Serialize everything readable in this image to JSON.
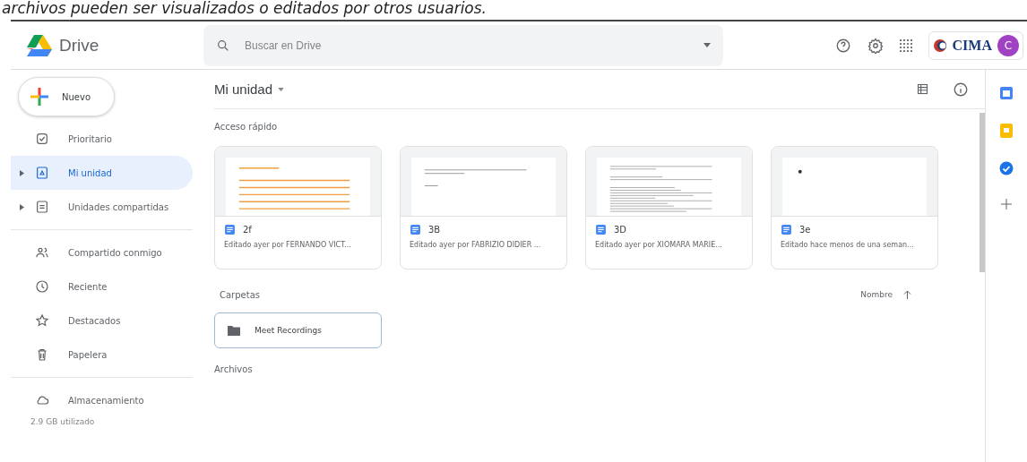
{
  "caption": "archivos pueden ser visualizados o editados por otros usuarios.",
  "header": {
    "app_name": "Drive",
    "search": {
      "placeholder": "Buscar en Drive"
    },
    "org_logo": "CIMA",
    "avatar": "C"
  },
  "new_button": "Nuevo",
  "sidebar": {
    "groups": [
      [
        {
          "label": "Prioritario",
          "selected": false,
          "expandable": false
        },
        {
          "label": "Mi unidad",
          "selected": true,
          "expandable": true
        },
        {
          "label": "Unidades compartidas",
          "selected": false,
          "expandable": true
        }
      ],
      [
        {
          "label": "Compartido conmigo",
          "selected": false,
          "expandable": false
        },
        {
          "label": "Reciente",
          "selected": false,
          "expandable": false
        },
        {
          "label": "Destacados",
          "selected": false,
          "expandable": false
        },
        {
          "label": "Papelera",
          "selected": false,
          "expandable": false
        }
      ],
      [
        {
          "label": "Almacenamiento",
          "selected": false,
          "expandable": false
        }
      ]
    ],
    "storage": "2.9 GB utilizado"
  },
  "breadcrumb": "Mi unidad",
  "quick_access": {
    "title": "Acceso rápido",
    "files": [
      {
        "name": "2f",
        "subtitle": "Editado ayer por FERNANDO VICT...",
        "kind": "orange"
      },
      {
        "name": "3B",
        "subtitle": "Editado ayer por FABRIZIO DIDIER ...",
        "kind": "sparse"
      },
      {
        "name": "3D",
        "subtitle": "Editado ayer por XIOMARA MARIE...",
        "kind": "dense"
      },
      {
        "name": "3e",
        "subtitle": "Editado hace menos de una seman...",
        "kind": "dot"
      }
    ]
  },
  "folders": {
    "title": "Carpetas",
    "sort": "Nombre",
    "items": [
      "Meet Recordings"
    ]
  },
  "files_title": "Archivos"
}
